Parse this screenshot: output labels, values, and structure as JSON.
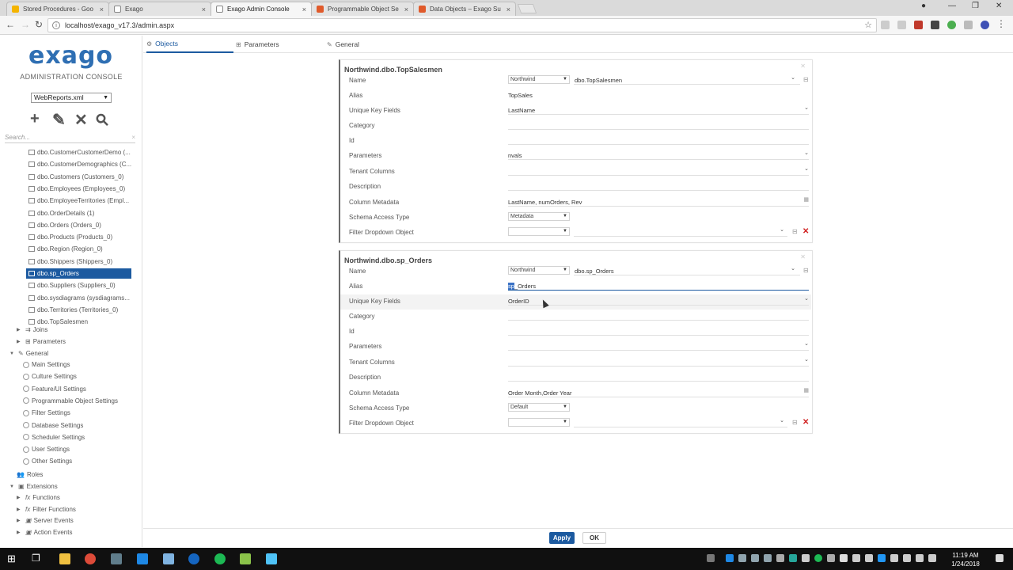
{
  "browser": {
    "tabs": [
      {
        "title": "Stored Procedures - Goo",
        "favicon_color": "#f4b400",
        "active": false
      },
      {
        "title": "Exago",
        "favicon_color": "#9e9e9e",
        "active": false
      },
      {
        "title": "Exago Admin Console",
        "favicon_color": "#9e9e9e",
        "active": true
      },
      {
        "title": "Programmable Object Se",
        "favicon_color": "#e05a2b",
        "active": false
      },
      {
        "title": "Data Objects – Exago Su",
        "favicon_color": "#e05a2b",
        "active": false
      }
    ],
    "tab_close": "×",
    "url": "localhost/exago_v17.3/admin.aspx",
    "window_controls": {
      "minimize": "—",
      "restore": "❐",
      "close": "✕"
    }
  },
  "sidebar": {
    "logo": "exago",
    "subtitle": "ADMINISTRATION CONSOLE",
    "config_file": "WebReports.xml",
    "tools": [
      "+",
      "✎",
      "✕",
      "⚲"
    ],
    "search_placeholder": "Search...",
    "search_clear": "×",
    "objects": [
      "dbo.CustomerCustomerDemo (...",
      "dbo.CustomerDemographics (C...",
      "dbo.Customers (Customers_0)",
      "dbo.Employees (Employees_0)",
      "dbo.EmployeeTerritories (Empl...",
      "dbo.OrderDetails (1)",
      "dbo.Orders (Orders_0)",
      "dbo.Products (Products_0)",
      "dbo.Region (Region_0)",
      "dbo.Shippers (Shippers_0)",
      "dbo.sp_Orders",
      "dbo.Suppliers (Suppliers_0)",
      "dbo.sysdiagrams (sysdiagrams...",
      "dbo.Territories (Territories_0)",
      "dbo.TopSalesmen"
    ],
    "selected_index": 10,
    "groups": {
      "joins": "Joins",
      "parameters": "Parameters",
      "general": "General",
      "general_items": [
        "Main Settings",
        "Culture Settings",
        "Feature/UI Settings",
        "Programmable Object Settings",
        "Filter Settings",
        "Database Settings",
        "Scheduler Settings",
        "User Settings",
        "Other Settings"
      ],
      "roles": "Roles",
      "extensions": "Extensions",
      "extension_items": [
        "Functions",
        "Filter Functions",
        "Server Events",
        "Action Events"
      ]
    }
  },
  "section_tabs": {
    "objects": "Objects",
    "parameters": "Parameters",
    "general": "General"
  },
  "cards": [
    {
      "title": "Northwind.dbo.TopSalesmen",
      "labels": {
        "name": "Name",
        "alias": "Alias",
        "unique_key": "Unique Key Fields",
        "category": "Category",
        "id": "Id",
        "parameters": "Parameters",
        "tenant": "Tenant Columns",
        "description": "Description",
        "column_metadata": "Column Metadata",
        "schema_access": "Schema Access Type",
        "filter_dropdown": "Filter Dropdown Object"
      },
      "name_source": "Northwind",
      "name_object": "dbo.TopSalesmen",
      "alias": "TopSales",
      "unique_key": "LastName",
      "category": "",
      "id": "",
      "parameters": "nvals",
      "tenant": "",
      "description": "",
      "column_metadata": "LastName, numOrders, Rev",
      "schema_access": "Metadata",
      "filter_source": "",
      "filter_object": ""
    },
    {
      "title": "Northwind.dbo.sp_Orders",
      "labels": {
        "name": "Name",
        "alias": "Alias",
        "unique_key": "Unique Key Fields",
        "category": "Category",
        "id": "Id",
        "parameters": "Parameters",
        "tenant": "Tenant Columns",
        "description": "Description",
        "column_metadata": "Column Metadata",
        "schema_access": "Schema Access Type",
        "filter_dropdown": "Filter Dropdown Object"
      },
      "name_source": "Northwind",
      "name_object": "dbo.sp_Orders",
      "alias_selected": "sp",
      "alias_rest": "_Orders",
      "unique_key": "OrderID",
      "category": "",
      "id": "",
      "parameters": "",
      "tenant": "",
      "description": "",
      "column_metadata": "Order Month,Order Year",
      "schema_access": "Default",
      "filter_source": "",
      "filter_object": ""
    }
  ],
  "buttons": {
    "apply": "Apply",
    "ok": "OK"
  },
  "taskbar": {
    "time": "11:19 AM",
    "date": "1/24/2018"
  },
  "colors": {
    "accent": "#1c5aa0",
    "logo": "#2f6fb3",
    "delete": "#d02020"
  }
}
